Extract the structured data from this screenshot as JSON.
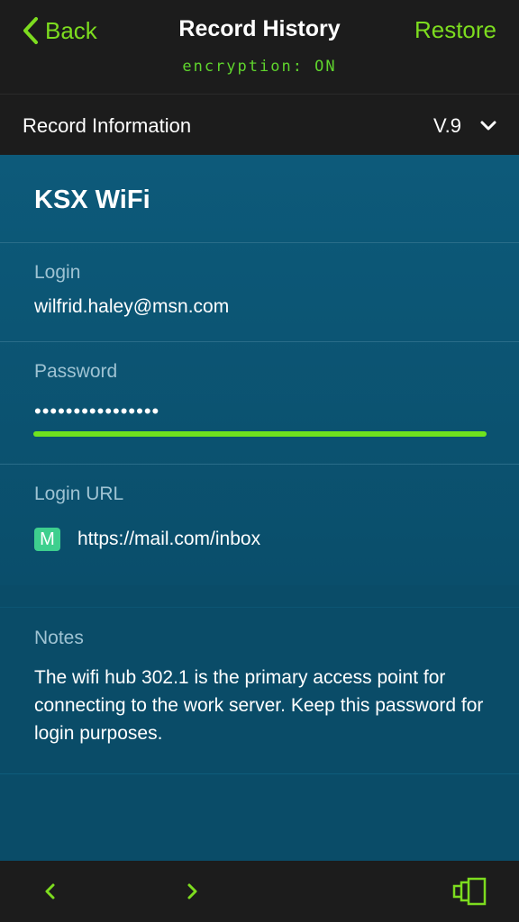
{
  "nav": {
    "back_label": "Back",
    "title": "Record History",
    "encryption": "encryption: ON",
    "restore_label": "Restore"
  },
  "info_bar": {
    "label": "Record Information",
    "version": "V.9"
  },
  "record": {
    "name": "KSX WiFi",
    "login_label": "Login",
    "login_value": "wilfrid.haley@msn.com",
    "password_label": "Password",
    "password_masked": "••••••••••••••••",
    "password_strength": 1.0,
    "url_label": "Login URL",
    "url_favicon": "M",
    "url_value": "https://mail.com/inbox"
  },
  "notes": {
    "label": "Notes",
    "body": "The wifi hub 302.1 is the primary access point for connecting to the work server. Keep this password for login purposes."
  },
  "toolbar": {
    "icons": [
      "chevron-left-icon",
      "chevron-right-icon",
      "pages-icon"
    ]
  },
  "colors": {
    "accent": "#7ddc1f",
    "nav_bg": "#1c1c1c",
    "card_bg": "#0d5a7a",
    "strength": "#6fe31e",
    "favicon": "#3ecf8e"
  }
}
